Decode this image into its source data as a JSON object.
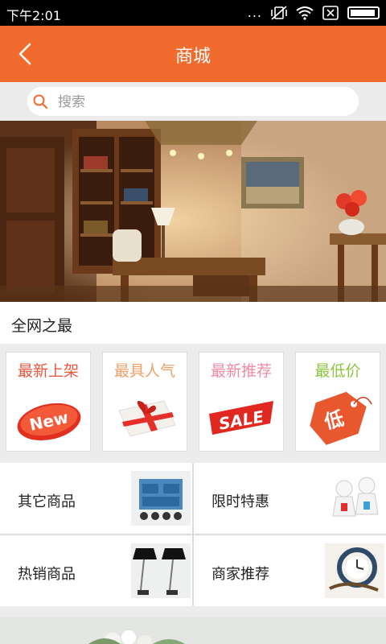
{
  "status_bar": {
    "time": "下午2:01",
    "dots": "..."
  },
  "header": {
    "title": "商城"
  },
  "search": {
    "placeholder": "搜索"
  },
  "section": {
    "title": "全网之最"
  },
  "promos": [
    {
      "label": "最新上架",
      "color": "#e9573f",
      "art": "new-badge-icon"
    },
    {
      "label": "最具人气",
      "color": "#f0a066",
      "art": "gift-box-icon"
    },
    {
      "label": "最新推荐",
      "color": "#f08aa6",
      "art": "sale-tag-icon"
    },
    {
      "label": "最低价",
      "color": "#8cc63f",
      "art": "low-price-tag-icon"
    }
  ],
  "categories": [
    {
      "label": "其它商品",
      "thumb": "cabinet-thumb"
    },
    {
      "label": "限时特惠",
      "thumb": "figurines-thumb"
    },
    {
      "label": "热销商品",
      "thumb": "lamps-thumb"
    },
    {
      "label": "商家推荐",
      "thumb": "clock-decor-thumb"
    }
  ],
  "colors": {
    "accent": "#f26b2e",
    "background": "#ececec"
  }
}
